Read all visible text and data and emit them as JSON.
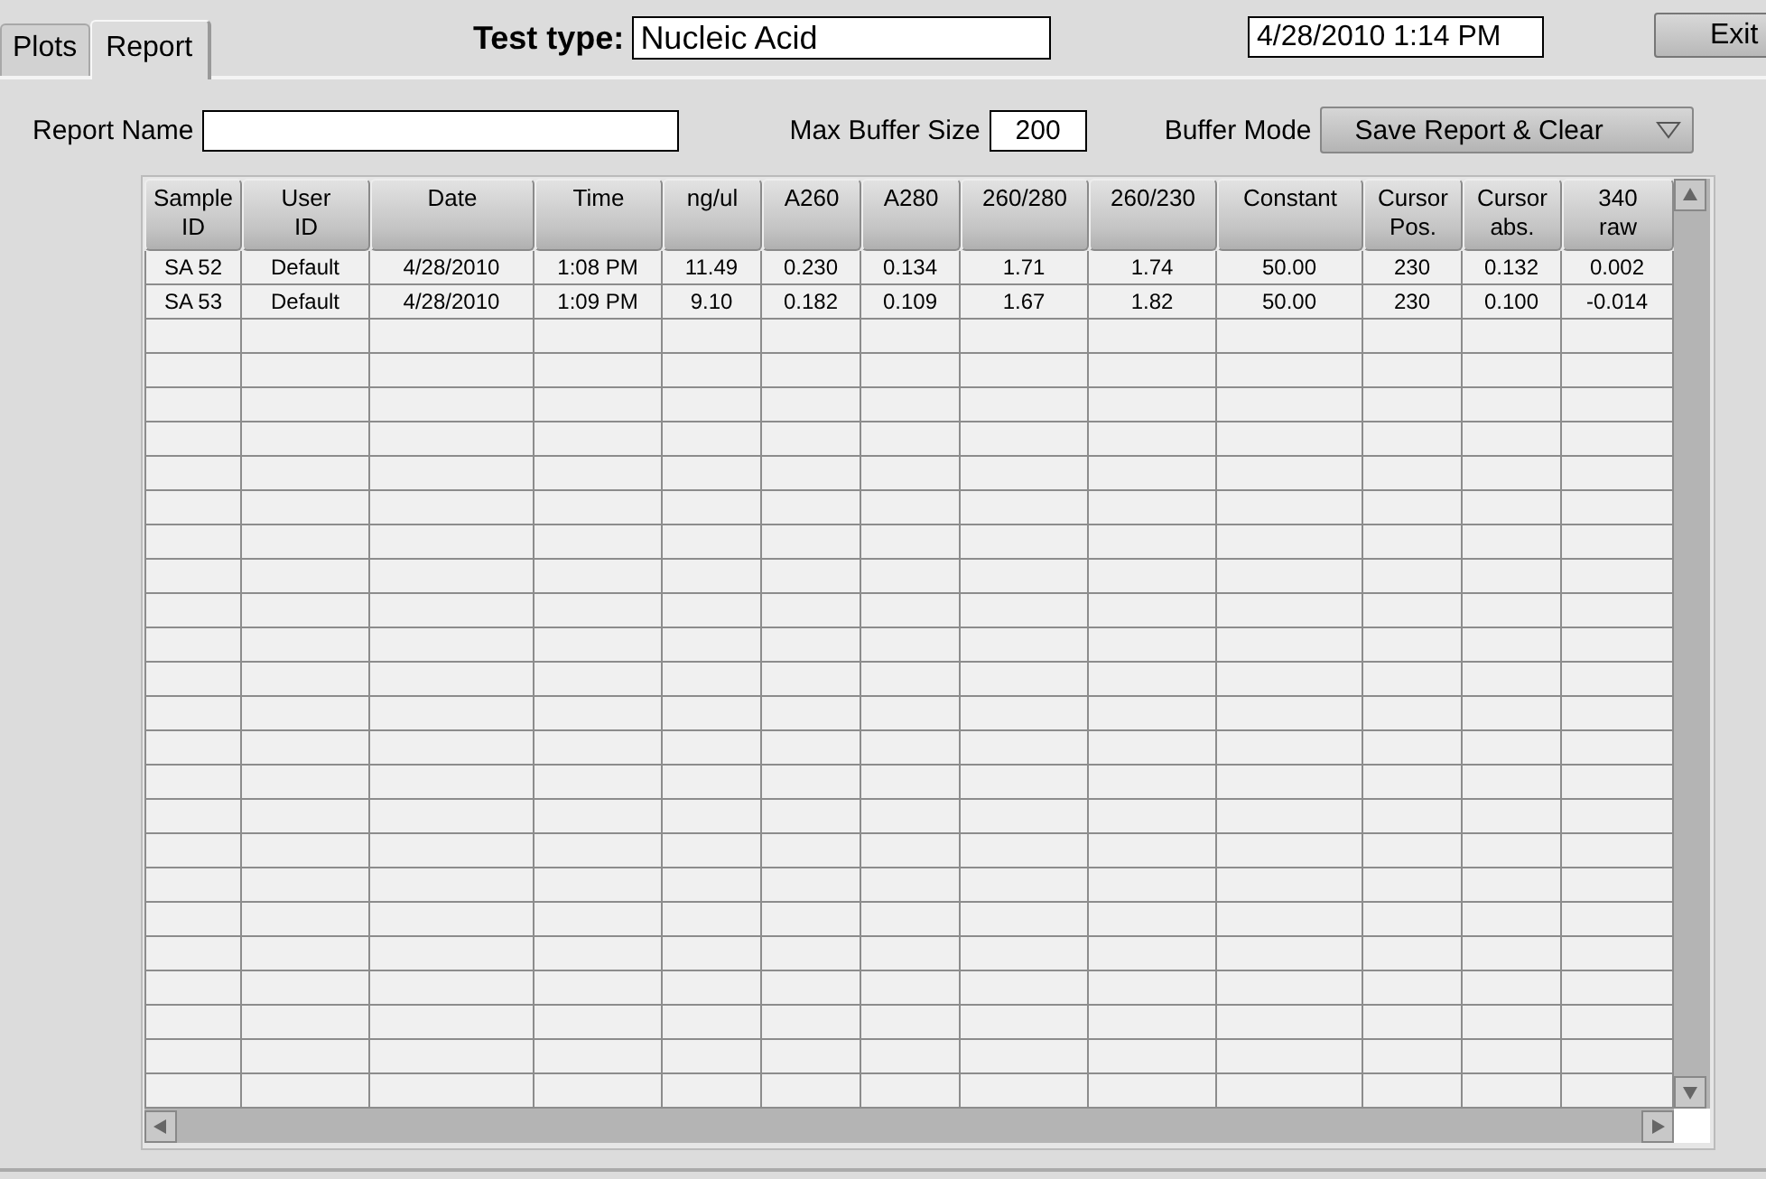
{
  "tabs": [
    {
      "label": "Plots",
      "selected": false
    },
    {
      "label": "Report",
      "selected": true
    }
  ],
  "test_type": {
    "label": "Test type:",
    "value": "Nucleic Acid"
  },
  "datetime": "4/28/2010  1:14 PM",
  "exit_button": "Exit",
  "report_name": {
    "label": "Report Name"
  },
  "max_buffer_size": {
    "label": "Max Buffer Size",
    "value": "200"
  },
  "buffer_mode": {
    "label": "Buffer Mode",
    "value": "Save Report & Clear"
  },
  "table": {
    "columns": [
      "Sample ID",
      "User ID",
      "Date",
      "Time",
      "ng/ul",
      "A260",
      "A280",
      "260/280",
      "260/230",
      "Constant",
      "Cursor Pos.",
      "Cursor abs.",
      "340 raw"
    ],
    "rows": [
      [
        "SA 52",
        "Default",
        "4/28/2010",
        "1:08 PM",
        "11.49",
        "0.230",
        "0.134",
        "1.71",
        "1.74",
        "50.00",
        "230",
        "0.132",
        "0.002"
      ],
      [
        "SA 53",
        "Default",
        "4/28/2010",
        "1:09 PM",
        "9.10",
        "0.182",
        "0.109",
        "1.67",
        "1.82",
        "50.00",
        "230",
        "0.100",
        "-0.014"
      ]
    ]
  }
}
